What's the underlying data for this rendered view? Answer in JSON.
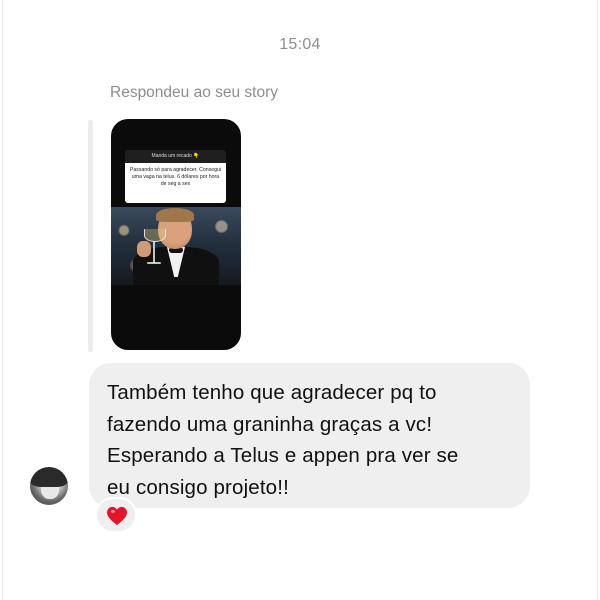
{
  "conversation": {
    "timestamp": "15:04",
    "story_reply_label": "Respondeu ao seu story",
    "story": {
      "sticker_header": "Manda um recado 👇",
      "sticker_text": "Passando só para agradecer. Consegui uma vaga na telus. 6 dólares por hora de seg a sex"
    },
    "message": {
      "text": "Também tenho que agradecer pq to\nfazendo uma graninha graças a vc!\nEsperando a Telus e appen pra ver se\neu consigo projeto!!"
    },
    "reaction": {
      "icon": "red-heart-icon",
      "color": "#e0162b"
    }
  }
}
